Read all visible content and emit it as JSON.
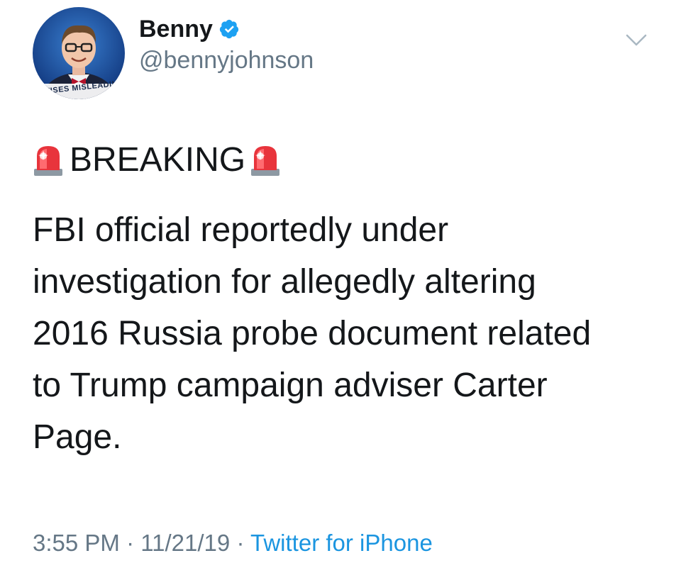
{
  "user": {
    "display_name": "Benny",
    "handle": "@bennyjohnson",
    "verified": true,
    "avatar_caption": "REVISES MISLEADING",
    "verified_icon": "verified-badge-icon"
  },
  "tweet": {
    "breaking_label": "BREAKING",
    "siren_icon": "police-siren-emoji",
    "body_lines": [
      "FBI official reportedly under",
      "investigation for allegedly altering",
      "2016 Russia probe document related",
      "to Trump campaign adviser Carter",
      "Page."
    ]
  },
  "meta": {
    "time": "3:55 PM",
    "separator": "·",
    "date": "11/21/19",
    "source": "Twitter for iPhone"
  },
  "menu": {
    "icon": "chevron-down-icon"
  },
  "colors": {
    "text": "#14171a",
    "secondary": "#657786",
    "link": "#1b95e0",
    "verified": "#1da1f2"
  }
}
